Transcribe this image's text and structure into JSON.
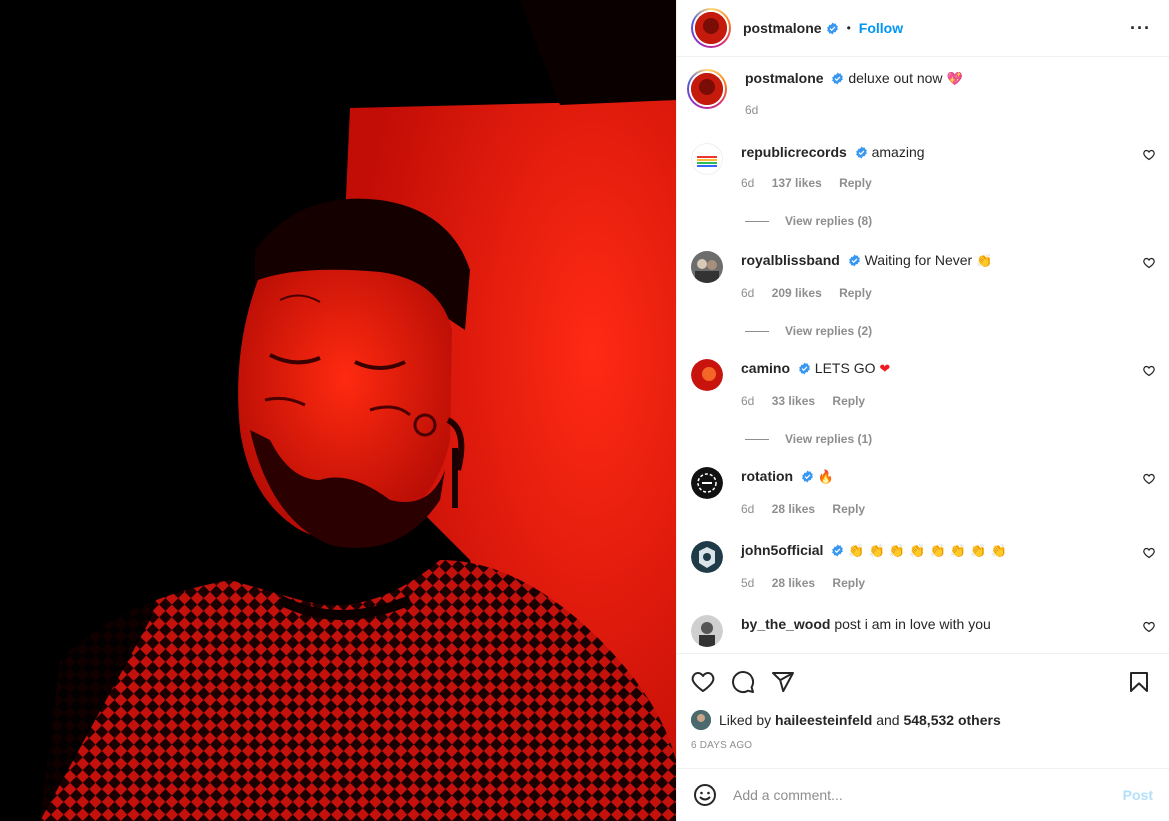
{
  "header": {
    "username": "postmalone",
    "separator": "•",
    "follow_label": "Follow",
    "more_label": "···"
  },
  "caption": {
    "username": "postmalone",
    "text": "deluxe out now",
    "emoji": "💖",
    "age": "6d"
  },
  "comments": [
    {
      "username": "republicrecords",
      "text": "amazing",
      "emoji": "",
      "age": "6d",
      "likes": "137 likes",
      "reply": "Reply",
      "view_replies": "View replies (8)"
    },
    {
      "username": "royalblissband",
      "text": "Waiting for Never",
      "emoji": "👏",
      "age": "6d",
      "likes": "209 likes",
      "reply": "Reply",
      "view_replies": "View replies (2)"
    },
    {
      "username": "camino",
      "text": "LETS GO",
      "emoji": "❤",
      "age": "6d",
      "likes": "33 likes",
      "reply": "Reply",
      "view_replies": "View replies (1)"
    },
    {
      "username": "rotation",
      "text": "",
      "emoji": "🔥",
      "age": "6d",
      "likes": "28 likes",
      "reply": "Reply",
      "view_replies": ""
    },
    {
      "username": "john5official",
      "text": "",
      "emoji": "👏 👏 👏 👏 👏 👏 👏 👏",
      "age": "5d",
      "likes": "28 likes",
      "reply": "Reply",
      "view_replies": ""
    },
    {
      "username": "by_the_wood",
      "text": "post i am in love with you",
      "emoji": "",
      "age": "",
      "likes": "",
      "reply": "",
      "view_replies": ""
    }
  ],
  "likes": {
    "prefix": "Liked by",
    "user": "haileesteinfeld",
    "and": "and",
    "others": "548,532 others"
  },
  "date": "6 DAYS AGO",
  "add_comment": {
    "placeholder": "Add a comment...",
    "post_label": "Post"
  },
  "icons": [
    "heart-icon",
    "comment-icon",
    "share-icon",
    "bookmark-icon",
    "smile-icon",
    "verified-icon",
    "more-icon"
  ],
  "colors": {
    "accent": "#0095f6",
    "verified": "#3897f0",
    "muted": "#8e8e8e",
    "media_red": "#e8150c"
  }
}
